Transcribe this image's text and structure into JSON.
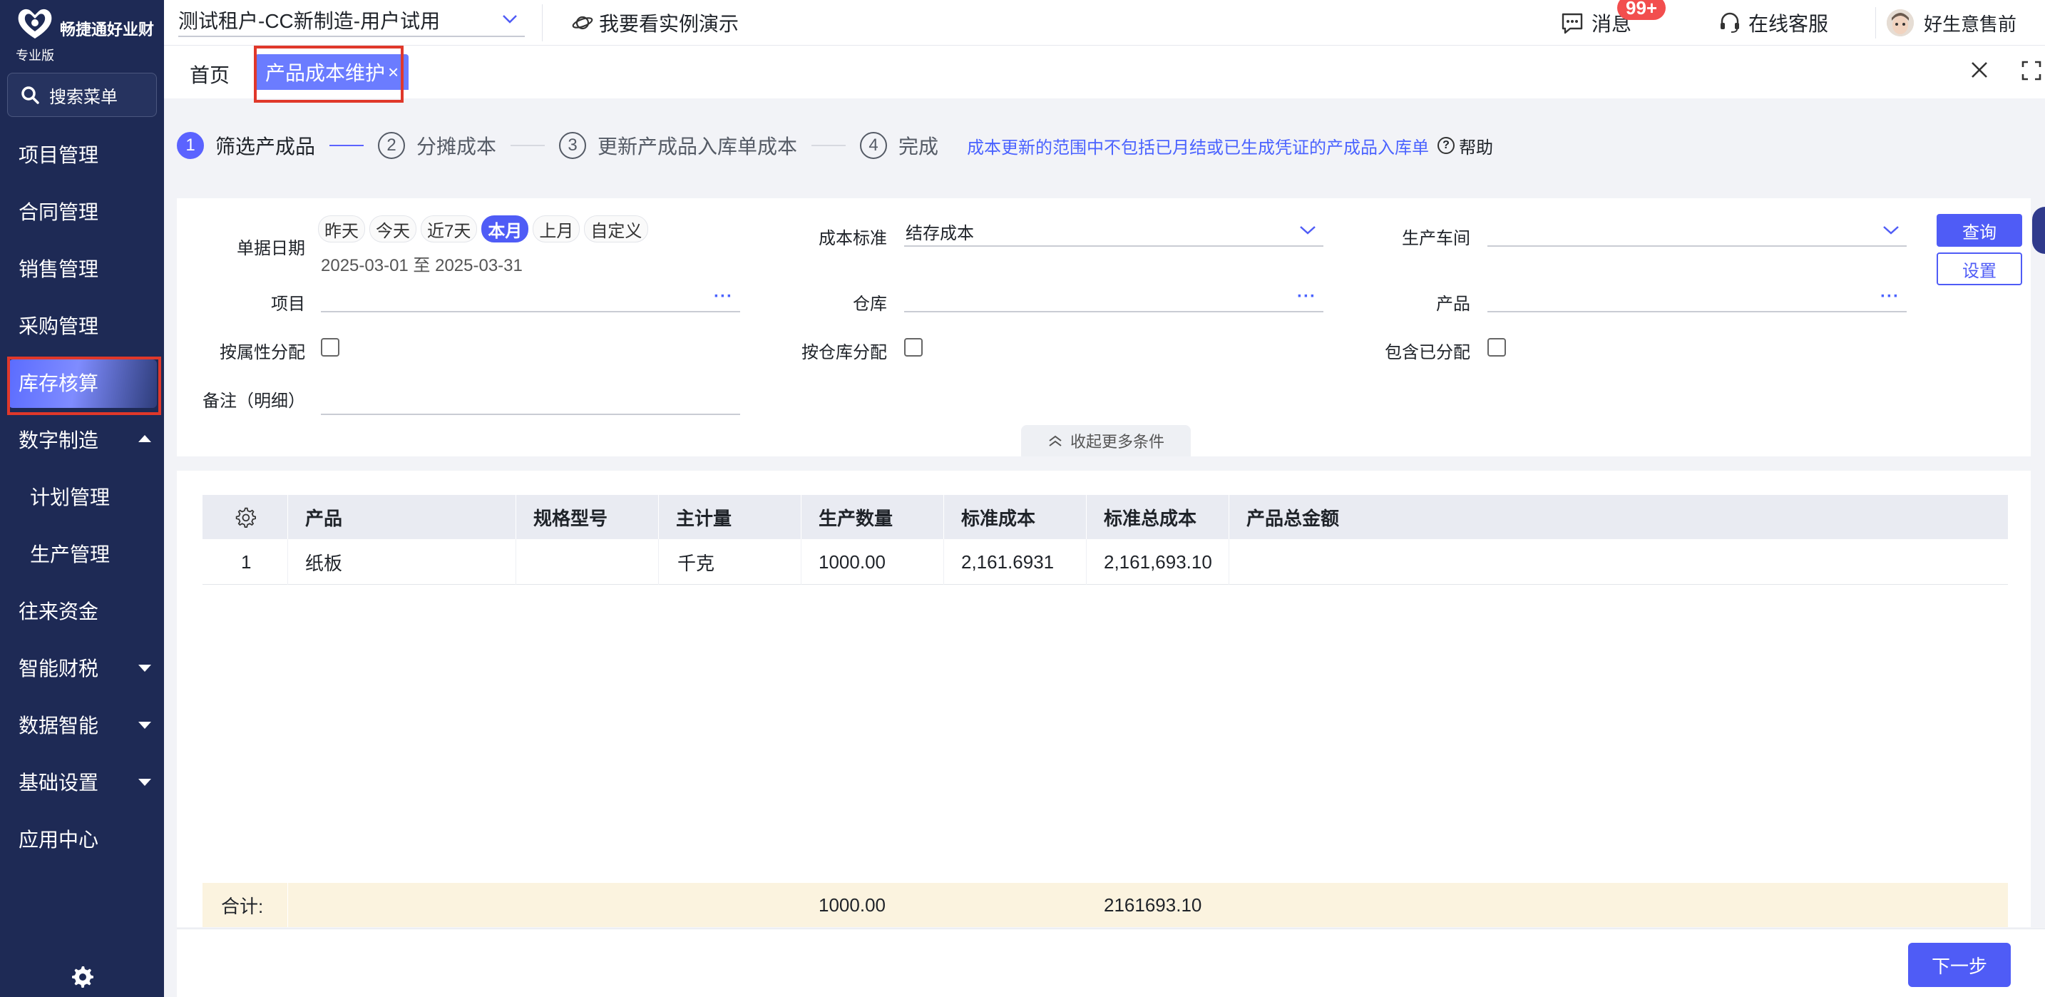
{
  "app": {
    "brand": "畅捷通好业财",
    "edition": "专业版"
  },
  "sidebar": {
    "search_label": "搜索菜单",
    "items": [
      {
        "label": "项目管理"
      },
      {
        "label": "合同管理"
      },
      {
        "label": "销售管理"
      },
      {
        "label": "采购管理"
      },
      {
        "label": "库存核算",
        "active": true
      },
      {
        "label": "数字制造",
        "expanded": true
      },
      {
        "label": "计划管理",
        "sub": true
      },
      {
        "label": "生产管理",
        "sub": true
      },
      {
        "label": "往来资金"
      },
      {
        "label": "智能财税"
      },
      {
        "label": "数据智能"
      },
      {
        "label": "基础设置"
      },
      {
        "label": "应用中心"
      }
    ]
  },
  "topbar": {
    "tenant": "测试租户-CC新制造-用户试用",
    "demo": "我要看实例演示",
    "messages": "消息",
    "badge": "99+",
    "service": "在线客服",
    "user": "好生意售前"
  },
  "tabs": {
    "home": "首页",
    "active": "产品成本维护",
    "close_mark": "×"
  },
  "steps": {
    "items": [
      {
        "num": "1",
        "label": "筛选产成品",
        "active": true
      },
      {
        "num": "2",
        "label": "分摊成本"
      },
      {
        "num": "3",
        "label": "更新产成品入库单成本"
      },
      {
        "num": "4",
        "label": "完成"
      }
    ],
    "tip": "成本更新的范围中不包括已月结或已生成凭证的产成品入库单",
    "help": "帮助"
  },
  "filter": {
    "date_label": "单据日期",
    "date_chips": [
      "昨天",
      "今天",
      "近7天",
      "本月",
      "上月",
      "自定义"
    ],
    "date_range": "2025-03-01 至 2025-03-31",
    "cost_standard_label": "成本标准",
    "cost_standard_value": "结存成本",
    "workshop_label": "生产车间",
    "workshop_value": "",
    "project_label": "项目",
    "warehouse_label": "仓库",
    "product_label": "产品",
    "by_attr_label": "按属性分配",
    "by_warehouse_label": "按仓库分配",
    "include_allocated_label": "包含已分配",
    "remark_label": "备注（明细）",
    "collapse_label": "收起更多条件",
    "query_button": "查询",
    "settings_button": "设置",
    "more_mark": "···"
  },
  "table": {
    "columns": [
      "产品",
      "规格型号",
      "主计量",
      "生产数量",
      "标准成本",
      "标准总成本",
      "产品总金额"
    ],
    "rows": [
      {
        "index": "1",
        "product": "纸板",
        "spec": "",
        "unit": "千克",
        "qty": "1000.00",
        "std_cost": "2,161.6931",
        "std_total": "2,161,693.10",
        "amount": ""
      }
    ],
    "footer": {
      "label": "合计:",
      "qty": "1000.00",
      "std_total": "2161693.10"
    }
  },
  "actions": {
    "next": "下一步"
  },
  "colors": {
    "primary": "#4f5cf6",
    "sidebar_bg": "#1e2a55",
    "highlight_box": "#e0382a",
    "badge": "#f24e4e",
    "footer_bg": "#fbf3df"
  }
}
